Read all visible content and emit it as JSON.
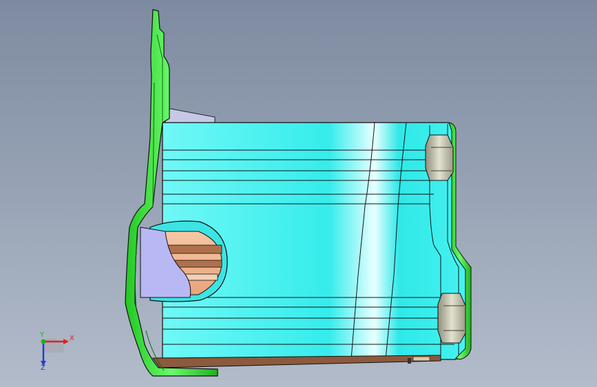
{
  "viewport": {
    "background_top": "#7d8aa0",
    "background_bottom": "#b3bccb"
  },
  "model": {
    "body_color": "#3ff0ef",
    "flange_color": "#3fe83f",
    "bore_color": "#f2b48f",
    "base_plate_color": "#8c5a3c",
    "nut_color": "#c9c9b4",
    "cover_color": "#b3b3f2"
  },
  "triad": {
    "x_label": "X",
    "y_label": "Y",
    "z_label": "Z",
    "x_color": "#e02020",
    "y_color": "#20b020",
    "z_color": "#2040d0"
  }
}
